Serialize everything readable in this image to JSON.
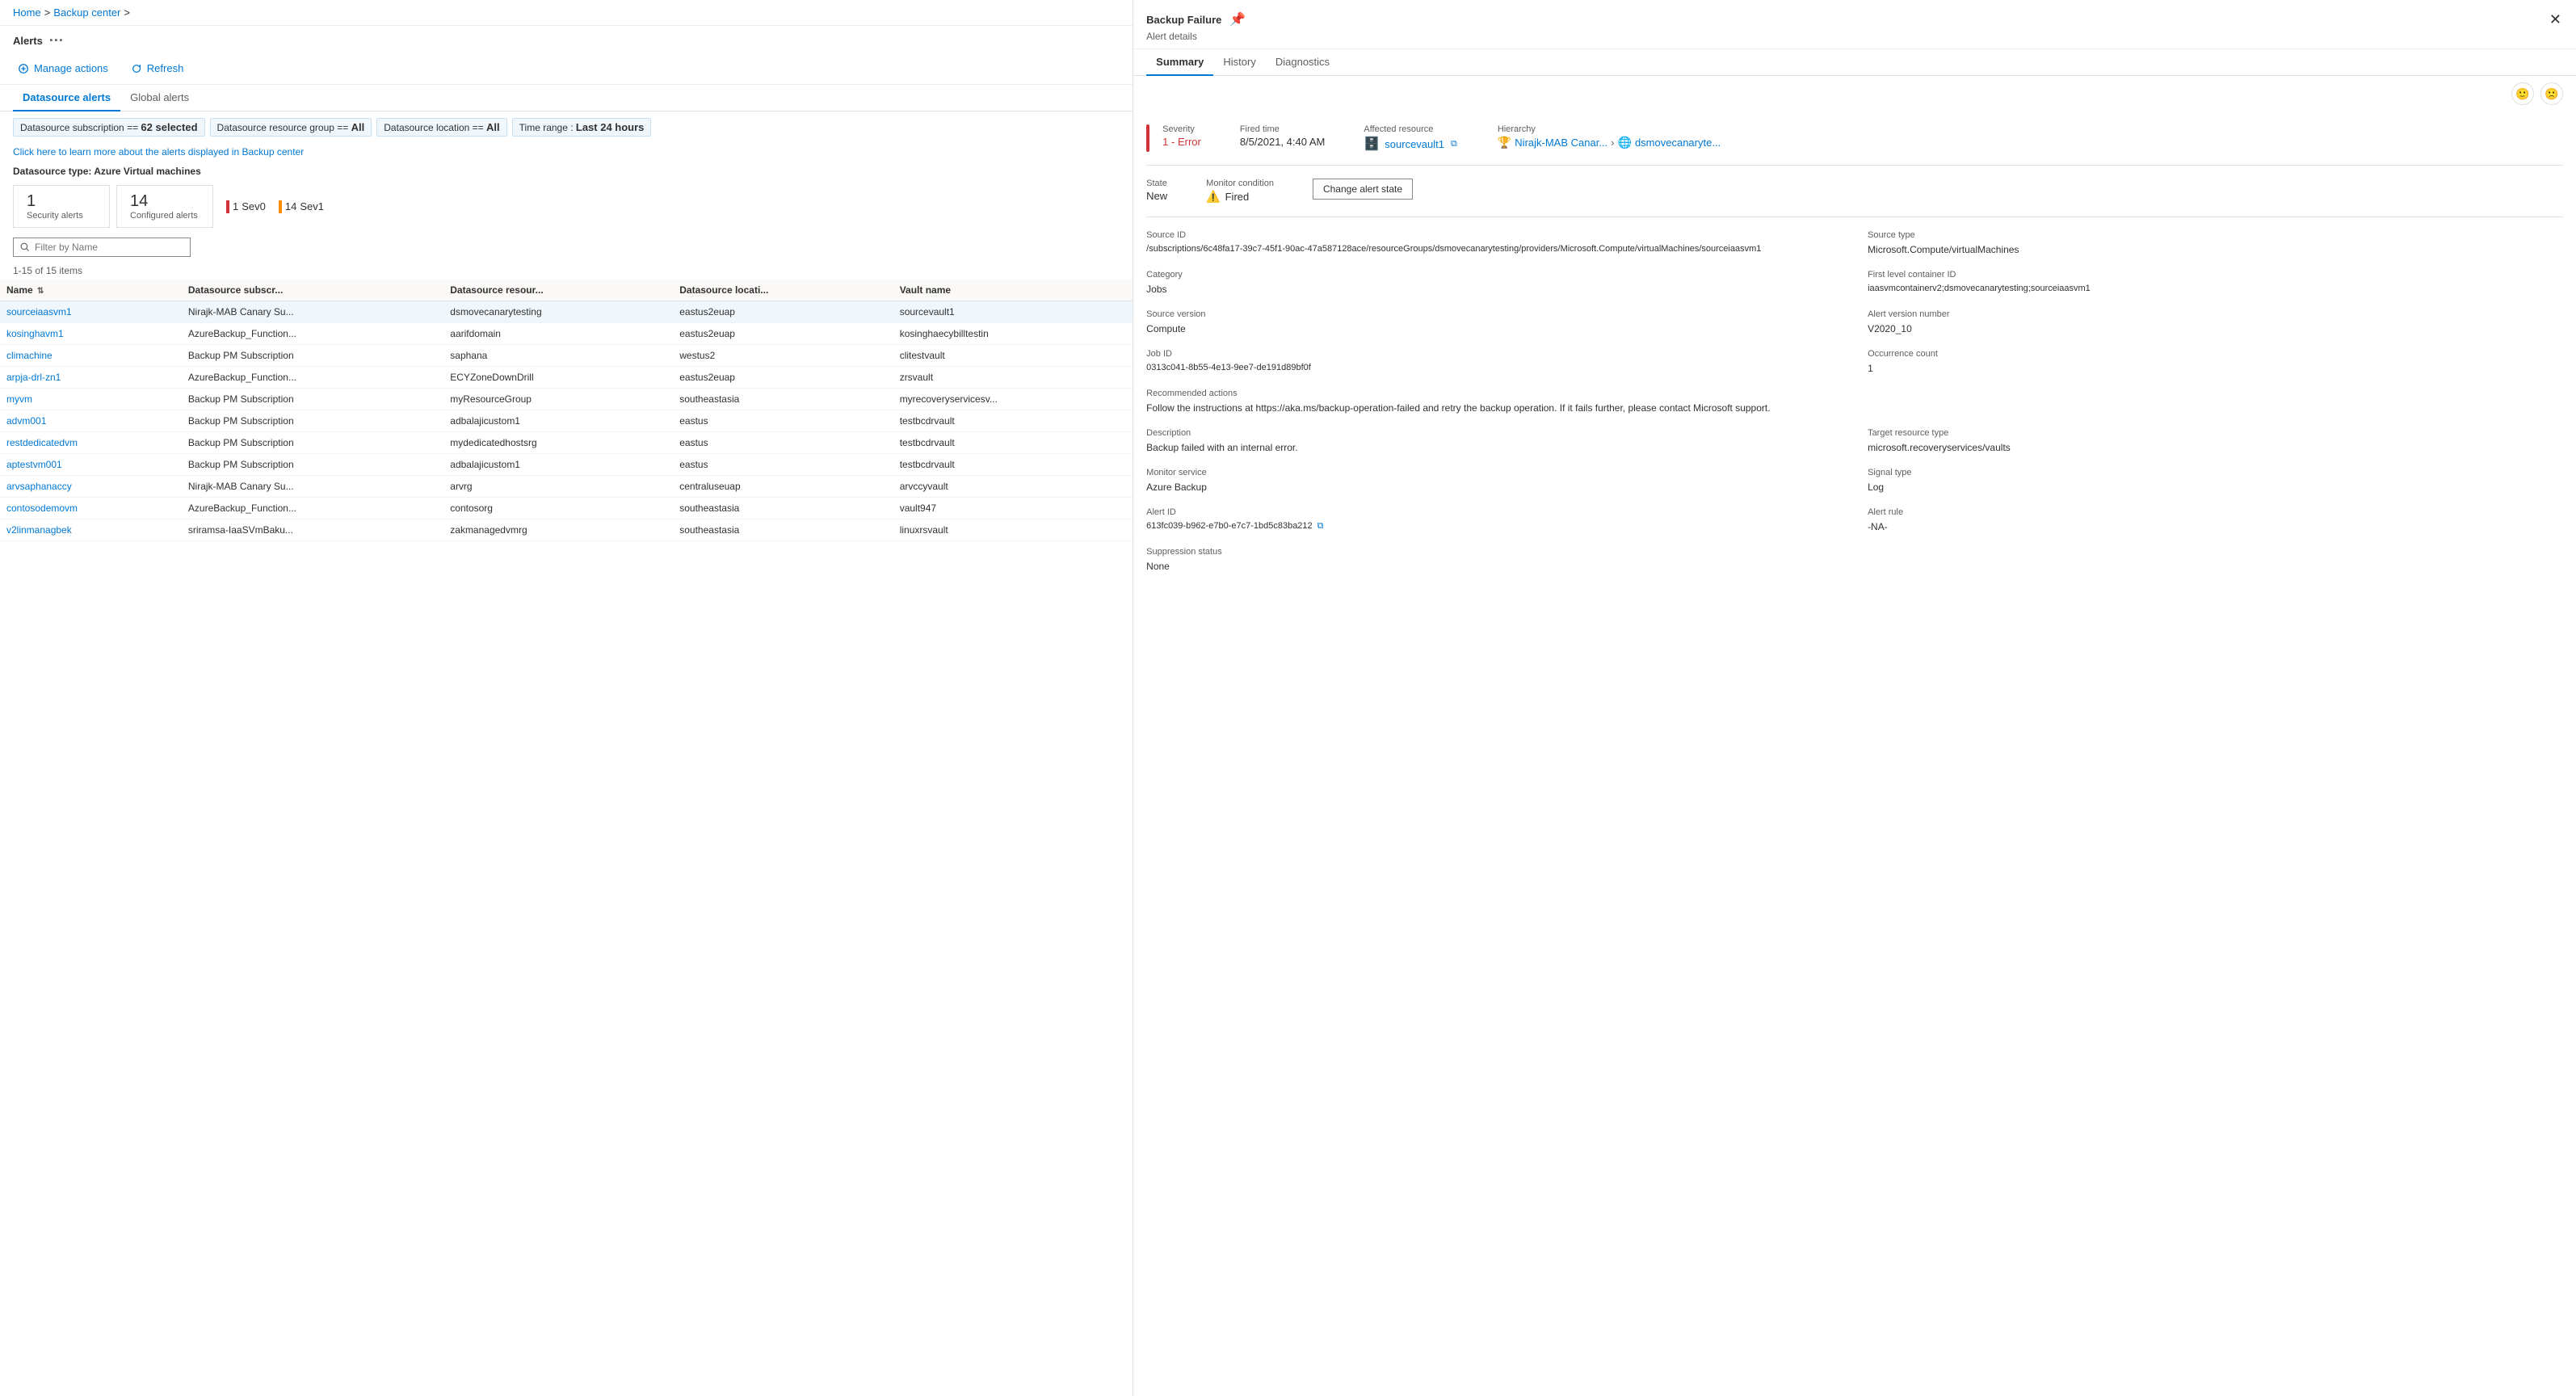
{
  "breadcrumb": {
    "home": "Home",
    "separator1": ">",
    "backup_center": "Backup center",
    "separator2": ">"
  },
  "page": {
    "title": "Alerts",
    "ellipsis": "···"
  },
  "toolbar": {
    "manage_actions_label": "Manage actions",
    "refresh_label": "Refresh"
  },
  "tabs": [
    {
      "id": "datasource",
      "label": "Datasource alerts",
      "active": true
    },
    {
      "id": "global",
      "label": "Global alerts",
      "active": false
    }
  ],
  "filters": [
    {
      "id": "subscription",
      "text": "Datasource subscription == ",
      "value": "62 selected"
    },
    {
      "id": "resource_group",
      "text": "Datasource resource group == ",
      "value": "All"
    },
    {
      "id": "location",
      "text": "Datasource location == ",
      "value": "All"
    },
    {
      "id": "time_range",
      "text": "Time range : ",
      "value": "Last 24 hours"
    }
  ],
  "learn_link": "Click here to learn more about the alerts displayed in Backup center",
  "datasource_type_label": "Datasource type: Azure Virtual machines",
  "stat_cards": [
    {
      "num": "1",
      "label": "Security alerts"
    },
    {
      "num": "14",
      "label": "Configured alerts"
    }
  ],
  "sev_badges": [
    {
      "severity": "Sev0",
      "count": "1",
      "color": "red"
    },
    {
      "severity": "Sev1",
      "count": "14",
      "color": "orange"
    }
  ],
  "search": {
    "placeholder": "Filter by Name"
  },
  "items_count": "1-15 of 15 items",
  "table": {
    "columns": [
      {
        "id": "name",
        "label": "Name",
        "sortable": true
      },
      {
        "id": "subscription",
        "label": "Datasource subscr..."
      },
      {
        "id": "resource_group",
        "label": "Datasource resour..."
      },
      {
        "id": "location",
        "label": "Datasource locati..."
      },
      {
        "id": "vault",
        "label": "Vault name"
      }
    ],
    "rows": [
      {
        "name": "sourceiaasvm1",
        "subscription": "Nirajk-MAB Canary Su...",
        "resource_group": "dsmovecanarytesting",
        "location": "eastus2euap",
        "vault": "sourcevault1",
        "selected": true
      },
      {
        "name": "kosinghavm1",
        "subscription": "AzureBackup_Function...",
        "resource_group": "aarifdomain",
        "location": "eastus2euap",
        "vault": "kosinghaecybilltestin"
      },
      {
        "name": "climachine",
        "subscription": "Backup PM Subscription",
        "resource_group": "saphana",
        "location": "westus2",
        "vault": "clitestvault"
      },
      {
        "name": "arpja-drl-zn1",
        "subscription": "AzureBackup_Function...",
        "resource_group": "ECYZoneDownDrill",
        "location": "eastus2euap",
        "vault": "zrsvault"
      },
      {
        "name": "myvm",
        "subscription": "Backup PM Subscription",
        "resource_group": "myResourceGroup",
        "location": "southeastasia",
        "vault": "myrecoveryservicesv..."
      },
      {
        "name": "advm001",
        "subscription": "Backup PM Subscription",
        "resource_group": "adbalajicustom1",
        "location": "eastus",
        "vault": "testbcdrvault"
      },
      {
        "name": "restdedicatedvm",
        "subscription": "Backup PM Subscription",
        "resource_group": "mydedicatedhostsrg",
        "location": "eastus",
        "vault": "testbcdrvault"
      },
      {
        "name": "aptestvm001",
        "subscription": "Backup PM Subscription",
        "resource_group": "adbalajicustom1",
        "location": "eastus",
        "vault": "testbcdrvault"
      },
      {
        "name": "arvsaphanaccy",
        "subscription": "Nirajk-MAB Canary Su...",
        "resource_group": "arvrg",
        "location": "centraluseuap",
        "vault": "arvccyvault"
      },
      {
        "name": "contosodemovm",
        "subscription": "AzureBackup_Function...",
        "resource_group": "contosorg",
        "location": "southeastasia",
        "vault": "vault947"
      },
      {
        "name": "v2linmanagbek",
        "subscription": "sriramsa-IaaSVmBaku...",
        "resource_group": "zakmanagedvmrg",
        "location": "southeastasia",
        "vault": "linuxrsvault"
      }
    ]
  },
  "detail_panel": {
    "title": "Backup Failure",
    "subtitle": "Alert details",
    "severity": {
      "label": "Severity",
      "value": "1 - Error"
    },
    "fired_time": {
      "label": "Fired time",
      "value": "8/5/2021, 4:40 AM"
    },
    "affected_resource": {
      "label": "Affected resource",
      "value": "sourcevault1"
    },
    "hierarchy": {
      "label": "Hierarchy",
      "items": [
        "Nirajk-MAB Canar...",
        ">",
        "dsmovecanaryte..."
      ]
    },
    "state": {
      "label": "State",
      "value": "New"
    },
    "monitor_condition": {
      "label": "Monitor condition",
      "value": "Fired"
    },
    "change_state_btn": "Change alert state",
    "source_id": {
      "label": "Source ID",
      "value": "/subscriptions/6c48fa17-39c7-45f1-90ac-47a587128ace/resourceGroups/dsmovecanarytesting/providers/Microsoft.Compute/virtualMachines/sourceiaasvm1"
    },
    "source_type": {
      "label": "Source type",
      "value": "Microsoft.Compute/virtualMachines"
    },
    "category": {
      "label": "Category",
      "value": "Jobs"
    },
    "first_level_container": {
      "label": "First level container ID",
      "value": "iaasvmcontainerv2;dsmovecanarytesting;sourceiaasvm1"
    },
    "source_version": {
      "label": "Source version",
      "value": "Compute"
    },
    "alert_version": {
      "label": "Alert version number",
      "value": "V2020_10"
    },
    "job_id": {
      "label": "Job ID",
      "value": "0313c041-8b55-4e13-9ee7-de191d89bf0f"
    },
    "occurrence_count": {
      "label": "Occurrence count",
      "value": "1"
    },
    "recommended_actions": {
      "label": "Recommended actions",
      "value": "Follow the instructions at https://aka.ms/backup-operation-failed and retry the backup operation. If it fails further, please contact Microsoft support."
    },
    "description": {
      "label": "Description",
      "value": "Backup failed with an internal error."
    },
    "target_resource_type": {
      "label": "Target resource type",
      "value": "microsoft.recoveryservices/vaults"
    },
    "monitor_service": {
      "label": "Monitor service",
      "value": "Azure Backup"
    },
    "signal_type": {
      "label": "Signal type",
      "value": "Log"
    },
    "alert_id": {
      "label": "Alert ID",
      "value": "613fc039-b962-e7b0-e7c7-1bd5c83ba212"
    },
    "alert_rule": {
      "label": "Alert rule",
      "value": "-NA-"
    },
    "suppression_status": {
      "label": "Suppression status",
      "value": "None"
    },
    "detail_tabs": [
      {
        "id": "summary",
        "label": "Summary",
        "active": true
      },
      {
        "id": "history",
        "label": "History",
        "active": false
      },
      {
        "id": "diagnostics",
        "label": "Diagnostics",
        "active": false
      }
    ]
  }
}
